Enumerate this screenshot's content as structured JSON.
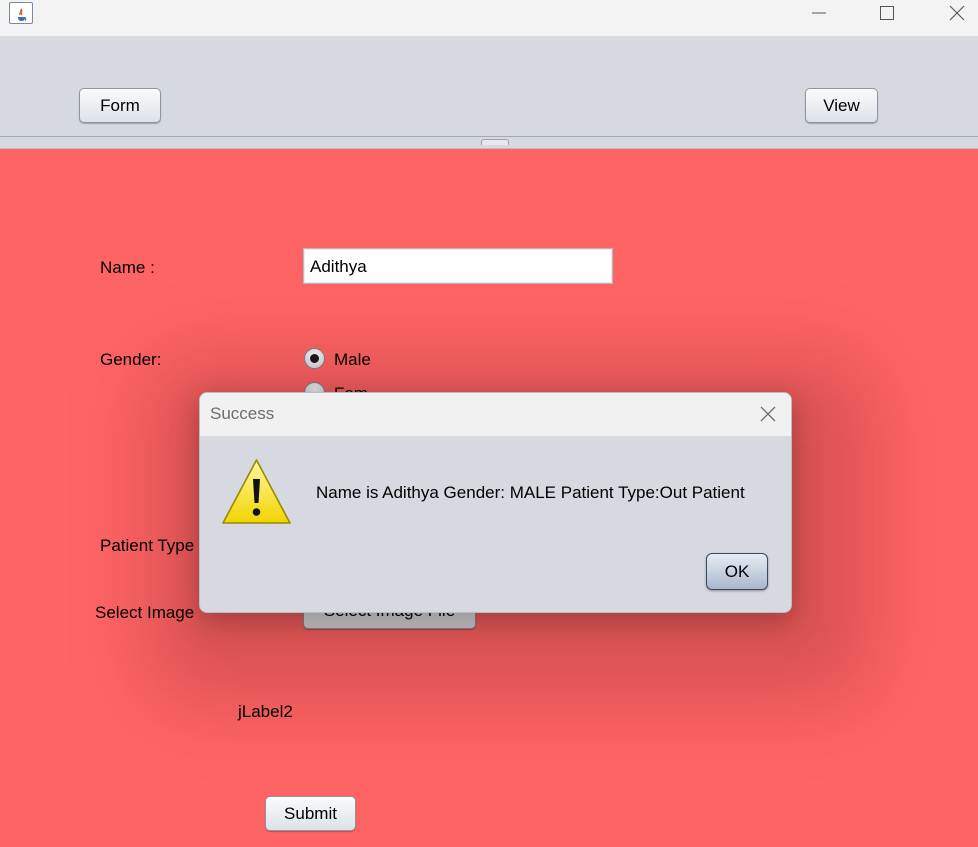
{
  "toolbar": {
    "form_label": "Form",
    "view_label": "View"
  },
  "form": {
    "name_label": "Name :",
    "name_value": "Adithya",
    "gender_label": "Gender:",
    "gender_options": [
      "Male",
      "Fem"
    ],
    "gender_selected": "Male",
    "patient_type_label": "Patient Type",
    "select_image_label": "Select Image",
    "select_image_button": "Select Image File",
    "image_preview_label": "jLabel2",
    "submit_label": "Submit"
  },
  "dialog": {
    "title": "Success",
    "message": "Name is Adithya Gender: MALE Patient Type:Out Patient",
    "ok_label": "OK",
    "icon": "warning-icon"
  },
  "colors": {
    "content_background": "#ff6464",
    "toolbar_background": "#d6d9df",
    "titlebar_background": "#f3f3f3"
  }
}
